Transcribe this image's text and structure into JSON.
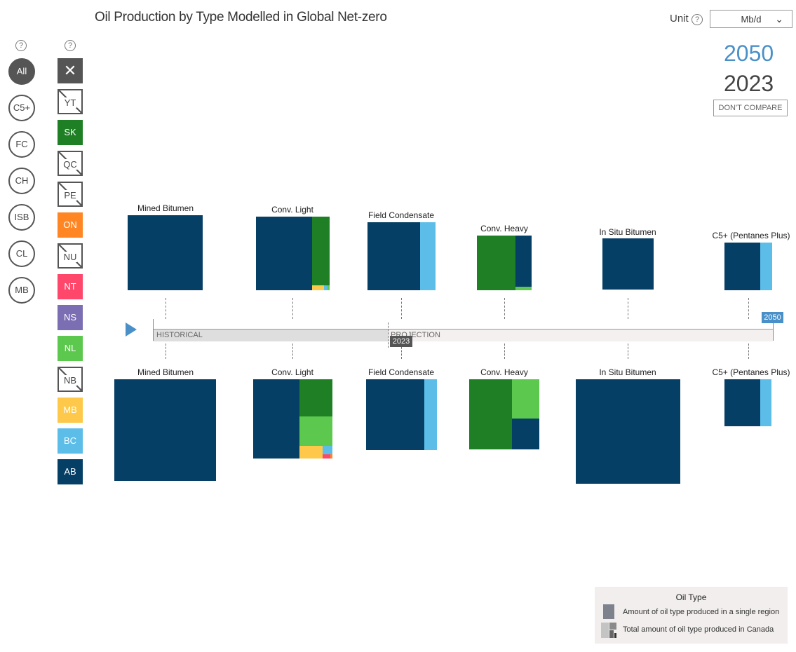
{
  "title": "Oil Production by Type Modelled in Global Net-zero",
  "unit": {
    "label": "Unit",
    "value": "Mb/d",
    "icon": "chevron-down-icon"
  },
  "years": {
    "compare": "2050",
    "base": "2023",
    "dont_compare": "DON'T COMPARE"
  },
  "colors": {
    "AB": "#053f65",
    "SK": "#1e7f24",
    "BC": "#5cbde8",
    "NL": "#5dc84e",
    "MB": "#fec94a",
    "NT": "#ff476b",
    "ON": "#ff8623",
    "NS": "#7c6eb3",
    "accent": "#4a90c8"
  },
  "oil_types": [
    "All",
    "C5+",
    "FC",
    "CH",
    "ISB",
    "CL",
    "MB"
  ],
  "regions": [
    "YT",
    "SK",
    "QC",
    "PE",
    "ON",
    "NU",
    "NT",
    "NS",
    "NL",
    "NB",
    "MB",
    "BC",
    "AB"
  ],
  "charts": {
    "labels": [
      "Mined Bitumen",
      "Conv. Light",
      "Field Condensate",
      "Conv. Heavy",
      "In Situ Bitumen",
      "C5+ (Pentanes Plus)"
    ]
  },
  "timeline": {
    "historical": "HISTORICAL",
    "projection": "PROJECTION",
    "current": "2023",
    "end": "2050"
  },
  "legend": {
    "title": "Oil Type",
    "single": "Amount of oil type produced in a single region",
    "total": "Total amount of oil type produced in Canada"
  }
}
